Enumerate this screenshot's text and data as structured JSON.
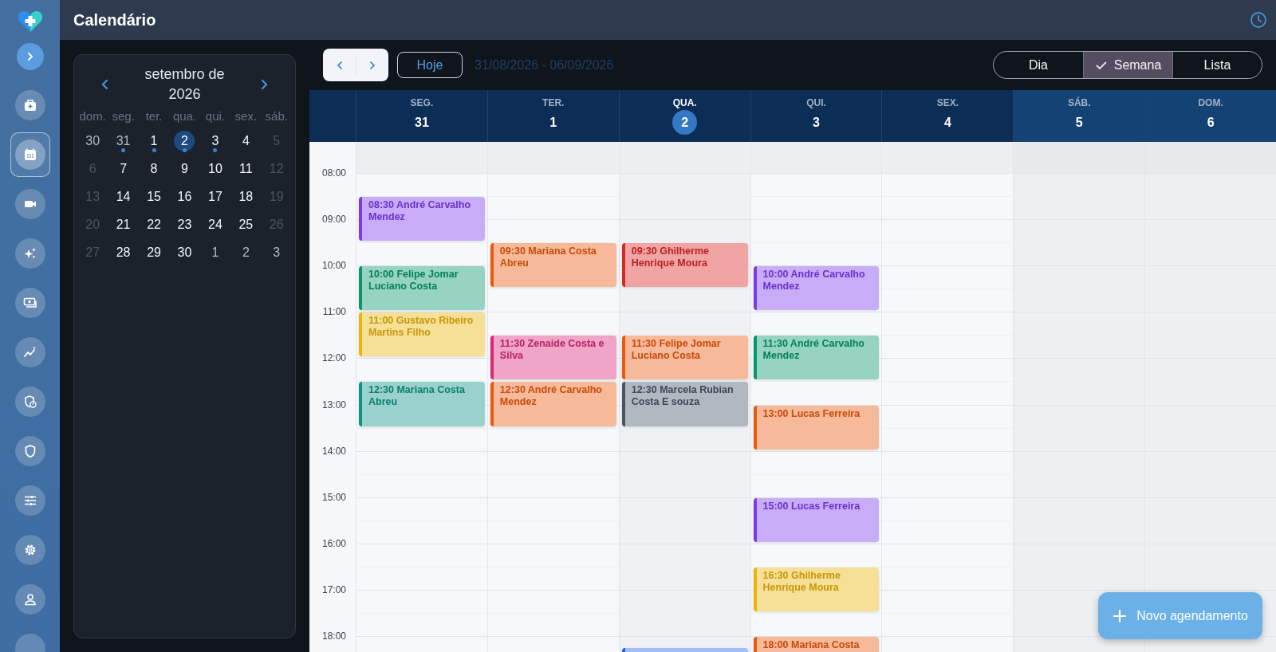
{
  "header": {
    "title": "Calendário"
  },
  "sidebar": {
    "items": [
      {
        "selected": false
      },
      {
        "selected": true
      },
      {
        "selected": false
      },
      {
        "selected": false
      },
      {
        "selected": false
      },
      {
        "selected": false
      },
      {
        "selected": false
      },
      {
        "selected": false
      },
      {
        "selected": false
      },
      {
        "selected": false
      },
      {
        "selected": false
      },
      {
        "selected": false
      }
    ]
  },
  "mini_calendar": {
    "title": "setembro de 2026",
    "weekdays": [
      "dom.",
      "seg.",
      "ter.",
      "qua.",
      "qui.",
      "sex.",
      "sáb."
    ],
    "weeks": [
      [
        {
          "day": "30",
          "outside": true,
          "weekend": false,
          "dot": false,
          "selected": false
        },
        {
          "day": "31",
          "outside": true,
          "weekend": false,
          "dot": true,
          "selected": false
        },
        {
          "day": "1",
          "outside": false,
          "weekend": false,
          "dot": true,
          "selected": false
        },
        {
          "day": "2",
          "outside": false,
          "weekend": false,
          "dot": true,
          "selected": true
        },
        {
          "day": "3",
          "outside": false,
          "weekend": false,
          "dot": true,
          "selected": false
        },
        {
          "day": "4",
          "outside": false,
          "weekend": false,
          "dot": false,
          "selected": false
        },
        {
          "day": "5",
          "outside": false,
          "weekend": true,
          "dot": false,
          "selected": false
        }
      ],
      [
        {
          "day": "6",
          "outside": false,
          "weekend": true,
          "dot": false,
          "selected": false
        },
        {
          "day": "7",
          "outside": false,
          "weekend": false,
          "dot": false,
          "selected": false
        },
        {
          "day": "8",
          "outside": false,
          "weekend": false,
          "dot": false,
          "selected": false
        },
        {
          "day": "9",
          "outside": false,
          "weekend": false,
          "dot": false,
          "selected": false
        },
        {
          "day": "10",
          "outside": false,
          "weekend": false,
          "dot": false,
          "selected": false
        },
        {
          "day": "11",
          "outside": false,
          "weekend": false,
          "dot": false,
          "selected": false
        },
        {
          "day": "12",
          "outside": false,
          "weekend": true,
          "dot": false,
          "selected": false
        }
      ],
      [
        {
          "day": "13",
          "outside": false,
          "weekend": true,
          "dot": false,
          "selected": false
        },
        {
          "day": "14",
          "outside": false,
          "weekend": false,
          "dot": false,
          "selected": false
        },
        {
          "day": "15",
          "outside": false,
          "weekend": false,
          "dot": false,
          "selected": false
        },
        {
          "day": "16",
          "outside": false,
          "weekend": false,
          "dot": false,
          "selected": false
        },
        {
          "day": "17",
          "outside": false,
          "weekend": false,
          "dot": false,
          "selected": false
        },
        {
          "day": "18",
          "outside": false,
          "weekend": false,
          "dot": false,
          "selected": false
        },
        {
          "day": "19",
          "outside": false,
          "weekend": true,
          "dot": false,
          "selected": false
        }
      ],
      [
        {
          "day": "20",
          "outside": false,
          "weekend": true,
          "dot": false,
          "selected": false
        },
        {
          "day": "21",
          "outside": false,
          "weekend": false,
          "dot": false,
          "selected": false
        },
        {
          "day": "22",
          "outside": false,
          "weekend": false,
          "dot": false,
          "selected": false
        },
        {
          "day": "23",
          "outside": false,
          "weekend": false,
          "dot": false,
          "selected": false
        },
        {
          "day": "24",
          "outside": false,
          "weekend": false,
          "dot": false,
          "selected": false
        },
        {
          "day": "25",
          "outside": false,
          "weekend": false,
          "dot": false,
          "selected": false
        },
        {
          "day": "26",
          "outside": false,
          "weekend": true,
          "dot": false,
          "selected": false
        }
      ],
      [
        {
          "day": "27",
          "outside": false,
          "weekend": true,
          "dot": false,
          "selected": false
        },
        {
          "day": "28",
          "outside": false,
          "weekend": false,
          "dot": false,
          "selected": false
        },
        {
          "day": "29",
          "outside": false,
          "weekend": false,
          "dot": false,
          "selected": false
        },
        {
          "day": "30",
          "outside": false,
          "weekend": false,
          "dot": false,
          "selected": false
        },
        {
          "day": "1",
          "outside": true,
          "weekend": false,
          "dot": false,
          "selected": false
        },
        {
          "day": "2",
          "outside": true,
          "weekend": false,
          "dot": false,
          "selected": false
        },
        {
          "day": "3",
          "outside": true,
          "weekend": false,
          "dot": false,
          "selected": false
        }
      ]
    ]
  },
  "toolbar": {
    "today": "Hoje",
    "range": "31/08/2026 - 06/09/2026",
    "views": [
      {
        "label": "Dia",
        "selected": false
      },
      {
        "label": "Semana",
        "selected": true
      },
      {
        "label": "Lista",
        "selected": false
      }
    ]
  },
  "week": {
    "hours": [
      "08:00",
      "09:00",
      "10:00",
      "11:00",
      "12:00",
      "13:00",
      "14:00",
      "15:00",
      "16:00",
      "17:00",
      "18:00"
    ],
    "days": [
      {
        "label": "SEG.",
        "number": "31",
        "selected": false,
        "weekend": false,
        "events": [
          {
            "time": "08:30",
            "name": "André Carvalho Mendez",
            "color": "#7c3aed"
          },
          {
            "time": "10:00",
            "name": "Felipe Jomar Luciano Costa",
            "color": "#059669"
          },
          {
            "time": "11:00",
            "name": "Gustavo Ribeiro Martins Filho",
            "color": "#eab308"
          },
          {
            "time": "12:30",
            "name": "Mariana Costa Abreu",
            "color": "#0d9488"
          }
        ]
      },
      {
        "label": "TER.",
        "number": "1",
        "selected": false,
        "weekend": false,
        "events": [
          {
            "time": "09:30",
            "name": "Mariana Costa Abreu",
            "color": "#ea580c"
          },
          {
            "time": "11:30",
            "name": "Zenaide Costa e Silva",
            "color": "#db2777"
          },
          {
            "time": "12:30",
            "name": "André Carvalho Mendez",
            "color": "#ea580c"
          }
        ]
      },
      {
        "label": "QUA.",
        "number": "2",
        "selected": true,
        "weekend": false,
        "events": [
          {
            "time": "09:30",
            "name": "Ghilherme Henrique Moura",
            "color": "#dc2626"
          },
          {
            "time": "11:30",
            "name": "Felipe Jomar Luciano Costa",
            "color": "#ea580c"
          },
          {
            "time": "12:30",
            "name": "Marcela Rubian Costa E souza",
            "color": "#475569"
          },
          {
            "color": "#2563eb"
          }
        ]
      },
      {
        "label": "QUI.",
        "number": "3",
        "selected": false,
        "weekend": false,
        "events": [
          {
            "time": "10:00",
            "name": "André Carvalho Mendez",
            "color": "#7c3aed"
          },
          {
            "time": "11:30",
            "name": "André Carvalho Mendez",
            "color": "#059669"
          },
          {
            "time": "13:00",
            "name": "Lucas Ferreira",
            "color": "#ea580c"
          },
          {
            "time": "15:00",
            "name": "Lucas Ferreira",
            "color": "#7c3aed"
          },
          {
            "time": "16:30",
            "name": "Ghilherme Henrique Moura",
            "color": "#eab308"
          },
          {
            "time": "18:00",
            "name": "Mariana Costa",
            "color": "#ea580c"
          }
        ]
      },
      {
        "label": "SEX.",
        "number": "4",
        "selected": false,
        "weekend": false
      },
      {
        "label": "SÁB.",
        "number": "5",
        "selected": false,
        "weekend": true
      },
      {
        "label": "DOM.",
        "number": "6",
        "selected": false,
        "weekend": true
      }
    ]
  },
  "fab": {
    "label": "Novo agendamento"
  }
}
